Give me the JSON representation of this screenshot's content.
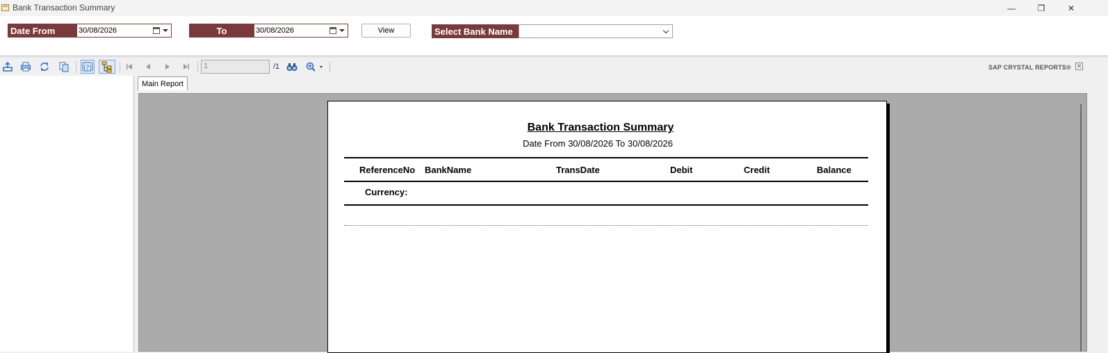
{
  "window": {
    "title": "Bank Transaction Summary",
    "minimize_glyph": "—",
    "restore_glyph": "❐",
    "close_glyph": "✕"
  },
  "filters": {
    "date_from_label": "Date From",
    "date_from_value": "30/08/2026",
    "to_label": "To",
    "to_value": "30/08/2026",
    "view_button": "View",
    "bank_label": "Select Bank Name",
    "bank_value": ""
  },
  "toolbar": {
    "current_page": "1",
    "page_count": "/1",
    "brand": "SAP CRYSTAL REPORTS®",
    "brand_close": "✕",
    "icons": [
      "export-icon",
      "print-icon",
      "refresh-icon",
      "copy-icon",
      "help-icon",
      "group-tree-icon",
      "first-page-icon",
      "previous-page-icon",
      "next-page-icon",
      "last-page-icon",
      "find-icon",
      "zoom-icon"
    ]
  },
  "viewer": {
    "tab_label": "Main Report"
  },
  "report": {
    "title": "Bank Transaction Summary",
    "subtitle": "Date From 30/08/2026 To 30/08/2026",
    "columns": [
      "ReferenceNo",
      "BankName",
      "TransDate",
      "Debit",
      "Credit",
      "Balance"
    ],
    "currency_label": "Currency:"
  },
  "colors": {
    "label_bg": "#7a3a3c",
    "viewer_bg": "#ababab",
    "toolbar_blue": "#2a6ebb"
  }
}
